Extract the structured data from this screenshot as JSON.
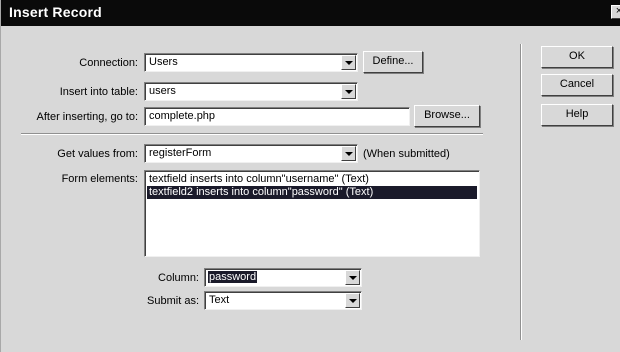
{
  "window": {
    "title": "Insert Record",
    "close_glyph": "×"
  },
  "connection": {
    "label": "Connection:",
    "value": "Users",
    "define_label": "Define..."
  },
  "table": {
    "label": "Insert into table:",
    "value": "users"
  },
  "after": {
    "label": "After inserting, go to:",
    "value": "complete.php",
    "browse_label": "Browse..."
  },
  "get_values": {
    "label": "Get values from:",
    "value": "registerForm",
    "note": "(When submitted)"
  },
  "form_elements": {
    "label": "Form elements:",
    "items": [
      {
        "text": "textfield inserts into column\"username\" (Text)",
        "selected": false
      },
      {
        "text": "textfield2 inserts into column\"password\" (Text)",
        "selected": true
      }
    ]
  },
  "column": {
    "label": "Column:",
    "value": "password"
  },
  "submit_as": {
    "label": "Submit as:",
    "value": "Text"
  },
  "actions": {
    "ok": "OK",
    "cancel": "Cancel",
    "help": "Help"
  }
}
